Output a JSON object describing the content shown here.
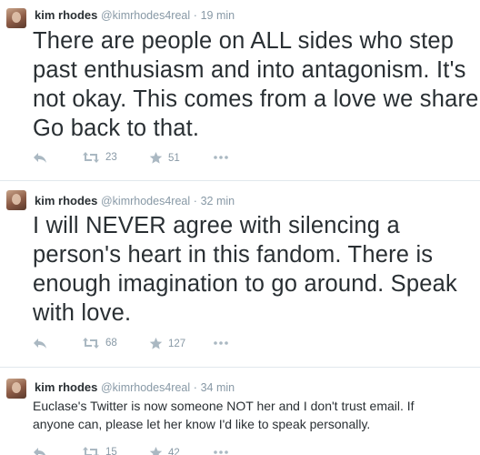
{
  "tweets": [
    {
      "name": "kim rhodes",
      "handle": "@kimrhodes4real",
      "dot": "·",
      "time": "19 min",
      "lines": [
        "There are people on ALL sides who step",
        "past enthusiasm and into antagonism. It's",
        "not okay. This comes from a love we share.",
        "Go back to that."
      ],
      "retweets": "23",
      "favorites": "51"
    },
    {
      "name": "kim rhodes",
      "handle": "@kimrhodes4real",
      "dot": "·",
      "time": "32 min",
      "lines": [
        "I will NEVER agree with silencing a",
        "person's heart in this fandom. There is",
        "enough imagination to go around. Speak",
        "with love."
      ],
      "retweets": "68",
      "favorites": "127"
    },
    {
      "name": "kim rhodes",
      "handle": "@kimrhodes4real",
      "dot": "·",
      "time": "34 min",
      "lines": [
        "Euclase's Twitter is now someone NOT her and I don't trust email. If",
        "anyone can, please let her know I'd like to speak personally."
      ],
      "retweets": "15",
      "favorites": "42"
    }
  ],
  "icons": {
    "reply": "reply-icon",
    "retweet": "retweet-icon",
    "favorite": "star-icon",
    "more": "more-icon"
  },
  "colors": {
    "text": "#292f33",
    "meta": "#8899a6",
    "icon": "#aab8c2",
    "divider": "#e1e8ed"
  }
}
